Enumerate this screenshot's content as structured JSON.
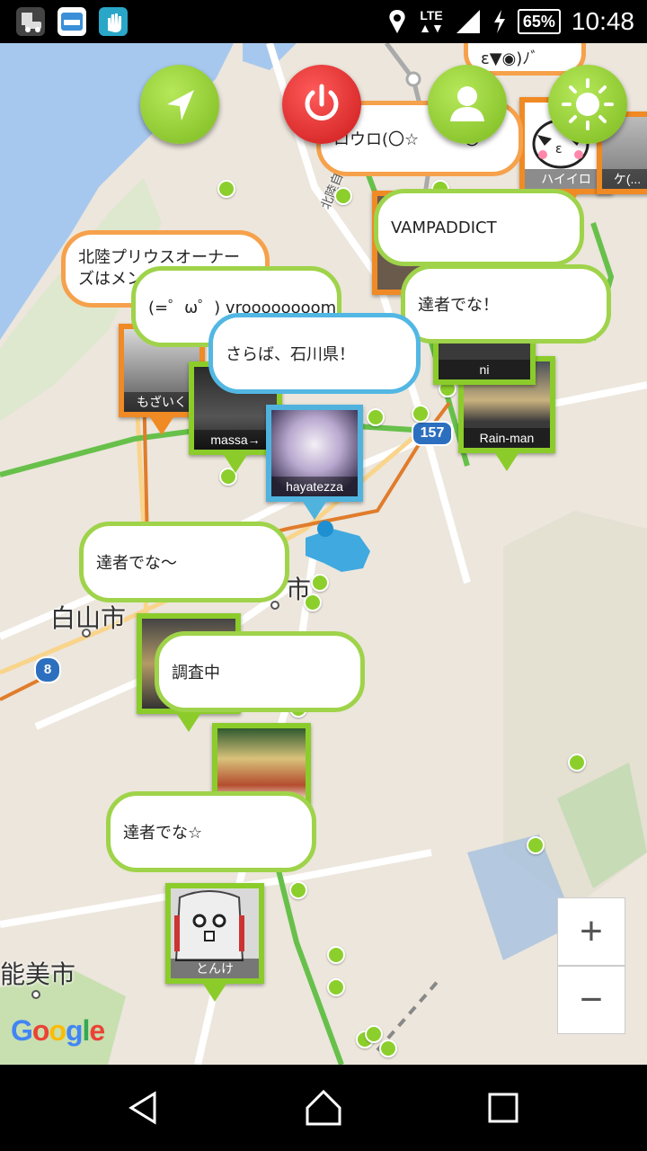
{
  "status": {
    "battery": "65%",
    "time": "10:48",
    "network": "LTE"
  },
  "map": {
    "places": [
      "白山市",
      "能美市",
      "市"
    ],
    "routes": [
      "157",
      "8"
    ],
    "road_label": "北陸自動車道",
    "attribution": "Google"
  },
  "fab_buttons": {
    "navigate": "navigate",
    "power": "power",
    "profile": "profile",
    "settings": "settings"
  },
  "markers": [
    {
      "name": "もざいく"
    },
    {
      "name": "massa→"
    },
    {
      "name": "hayatezza"
    },
    {
      "name": "Rain-man"
    },
    {
      "name": "ハイイロ"
    },
    {
      "name": "ケ(..."
    },
    {
      "name": "ni"
    },
    {
      "name": "とんけ"
    }
  ],
  "bubbles": [
    "ε▼◉)ﾉﾞ",
    "ロウロ(〇☆",
    "〇",
    "VAMPADDICT",
    "北陸プリウスオーナーズはメン",
    "(=゜ω゜) vroooooooom",
    "達者でな！",
    "さらば、石川県！",
    "達者でな〜",
    "調査中",
    "達者でな☆"
  ],
  "zoom": {
    "in": "+",
    "out": "−"
  },
  "colors": {
    "green": "#8bcc2b",
    "orange": "#f08a24",
    "blue": "#4fb3de",
    "red": "#d62020"
  }
}
